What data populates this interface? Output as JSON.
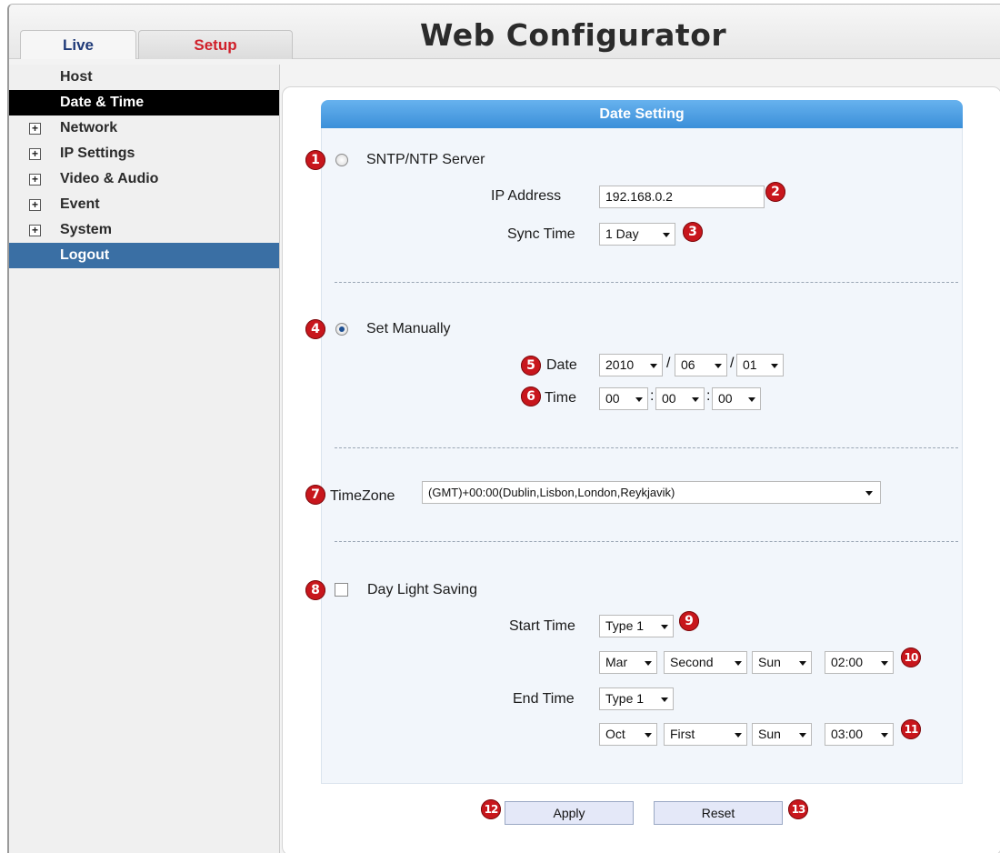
{
  "header": {
    "title": "Web Configurator",
    "tabs": [
      {
        "label": "Live"
      },
      {
        "label": "Setup"
      }
    ]
  },
  "sidebar": {
    "items": [
      {
        "label": "Host",
        "expandable": false
      },
      {
        "label": "Date & Time",
        "expandable": false,
        "active": true
      },
      {
        "label": "Network",
        "expandable": true
      },
      {
        "label": "IP Settings",
        "expandable": true
      },
      {
        "label": "Video & Audio",
        "expandable": true
      },
      {
        "label": "Event",
        "expandable": true
      },
      {
        "label": "System",
        "expandable": true
      },
      {
        "label": "Logout",
        "expandable": false
      }
    ],
    "expand_glyph": "+"
  },
  "date_setting": {
    "header": "Date Setting",
    "sntp": {
      "label": "SNTP/NTP Server",
      "selected": false,
      "ip_label": "IP Address",
      "ip_value": "192.168.0.2",
      "sync_label": "Sync Time",
      "sync_value": "1 Day"
    },
    "manual": {
      "label": "Set Manually",
      "selected": true,
      "date_label": "Date",
      "date": {
        "year": "2010",
        "month": "06",
        "day": "01"
      },
      "time_label": "Time",
      "time": {
        "hour": "00",
        "minute": "00",
        "second": "00"
      },
      "date_sep": "/",
      "time_sep": ":"
    },
    "timezone": {
      "label": "TimeZone",
      "value": "(GMT)+00:00(Dublin,Lisbon,London,Reykjavik)"
    },
    "dst": {
      "label": "Day Light Saving",
      "checked": false,
      "start_label": "Start Time",
      "start_type": "Type 1",
      "start": {
        "month": "Mar",
        "week": "Second",
        "day": "Sun",
        "time": "02:00"
      },
      "end_label": "End Time",
      "end_type": "Type 1",
      "end": {
        "month": "Oct",
        "week": "First",
        "day": "Sun",
        "time": "03:00"
      }
    },
    "buttons": {
      "apply": "Apply",
      "reset": "Reset"
    }
  },
  "callouts": [
    "1",
    "2",
    "3",
    "4",
    "5",
    "6",
    "7",
    "8",
    "9",
    "10",
    "11",
    "12",
    "13"
  ],
  "colors": {
    "accent_header": "#3b8fd9",
    "active_nav": "#000000",
    "logout_nav": "#3a6fa4",
    "callout": "#c8161c",
    "setup_tab_text": "#d0202a",
    "live_tab_text": "#1f3a78"
  }
}
